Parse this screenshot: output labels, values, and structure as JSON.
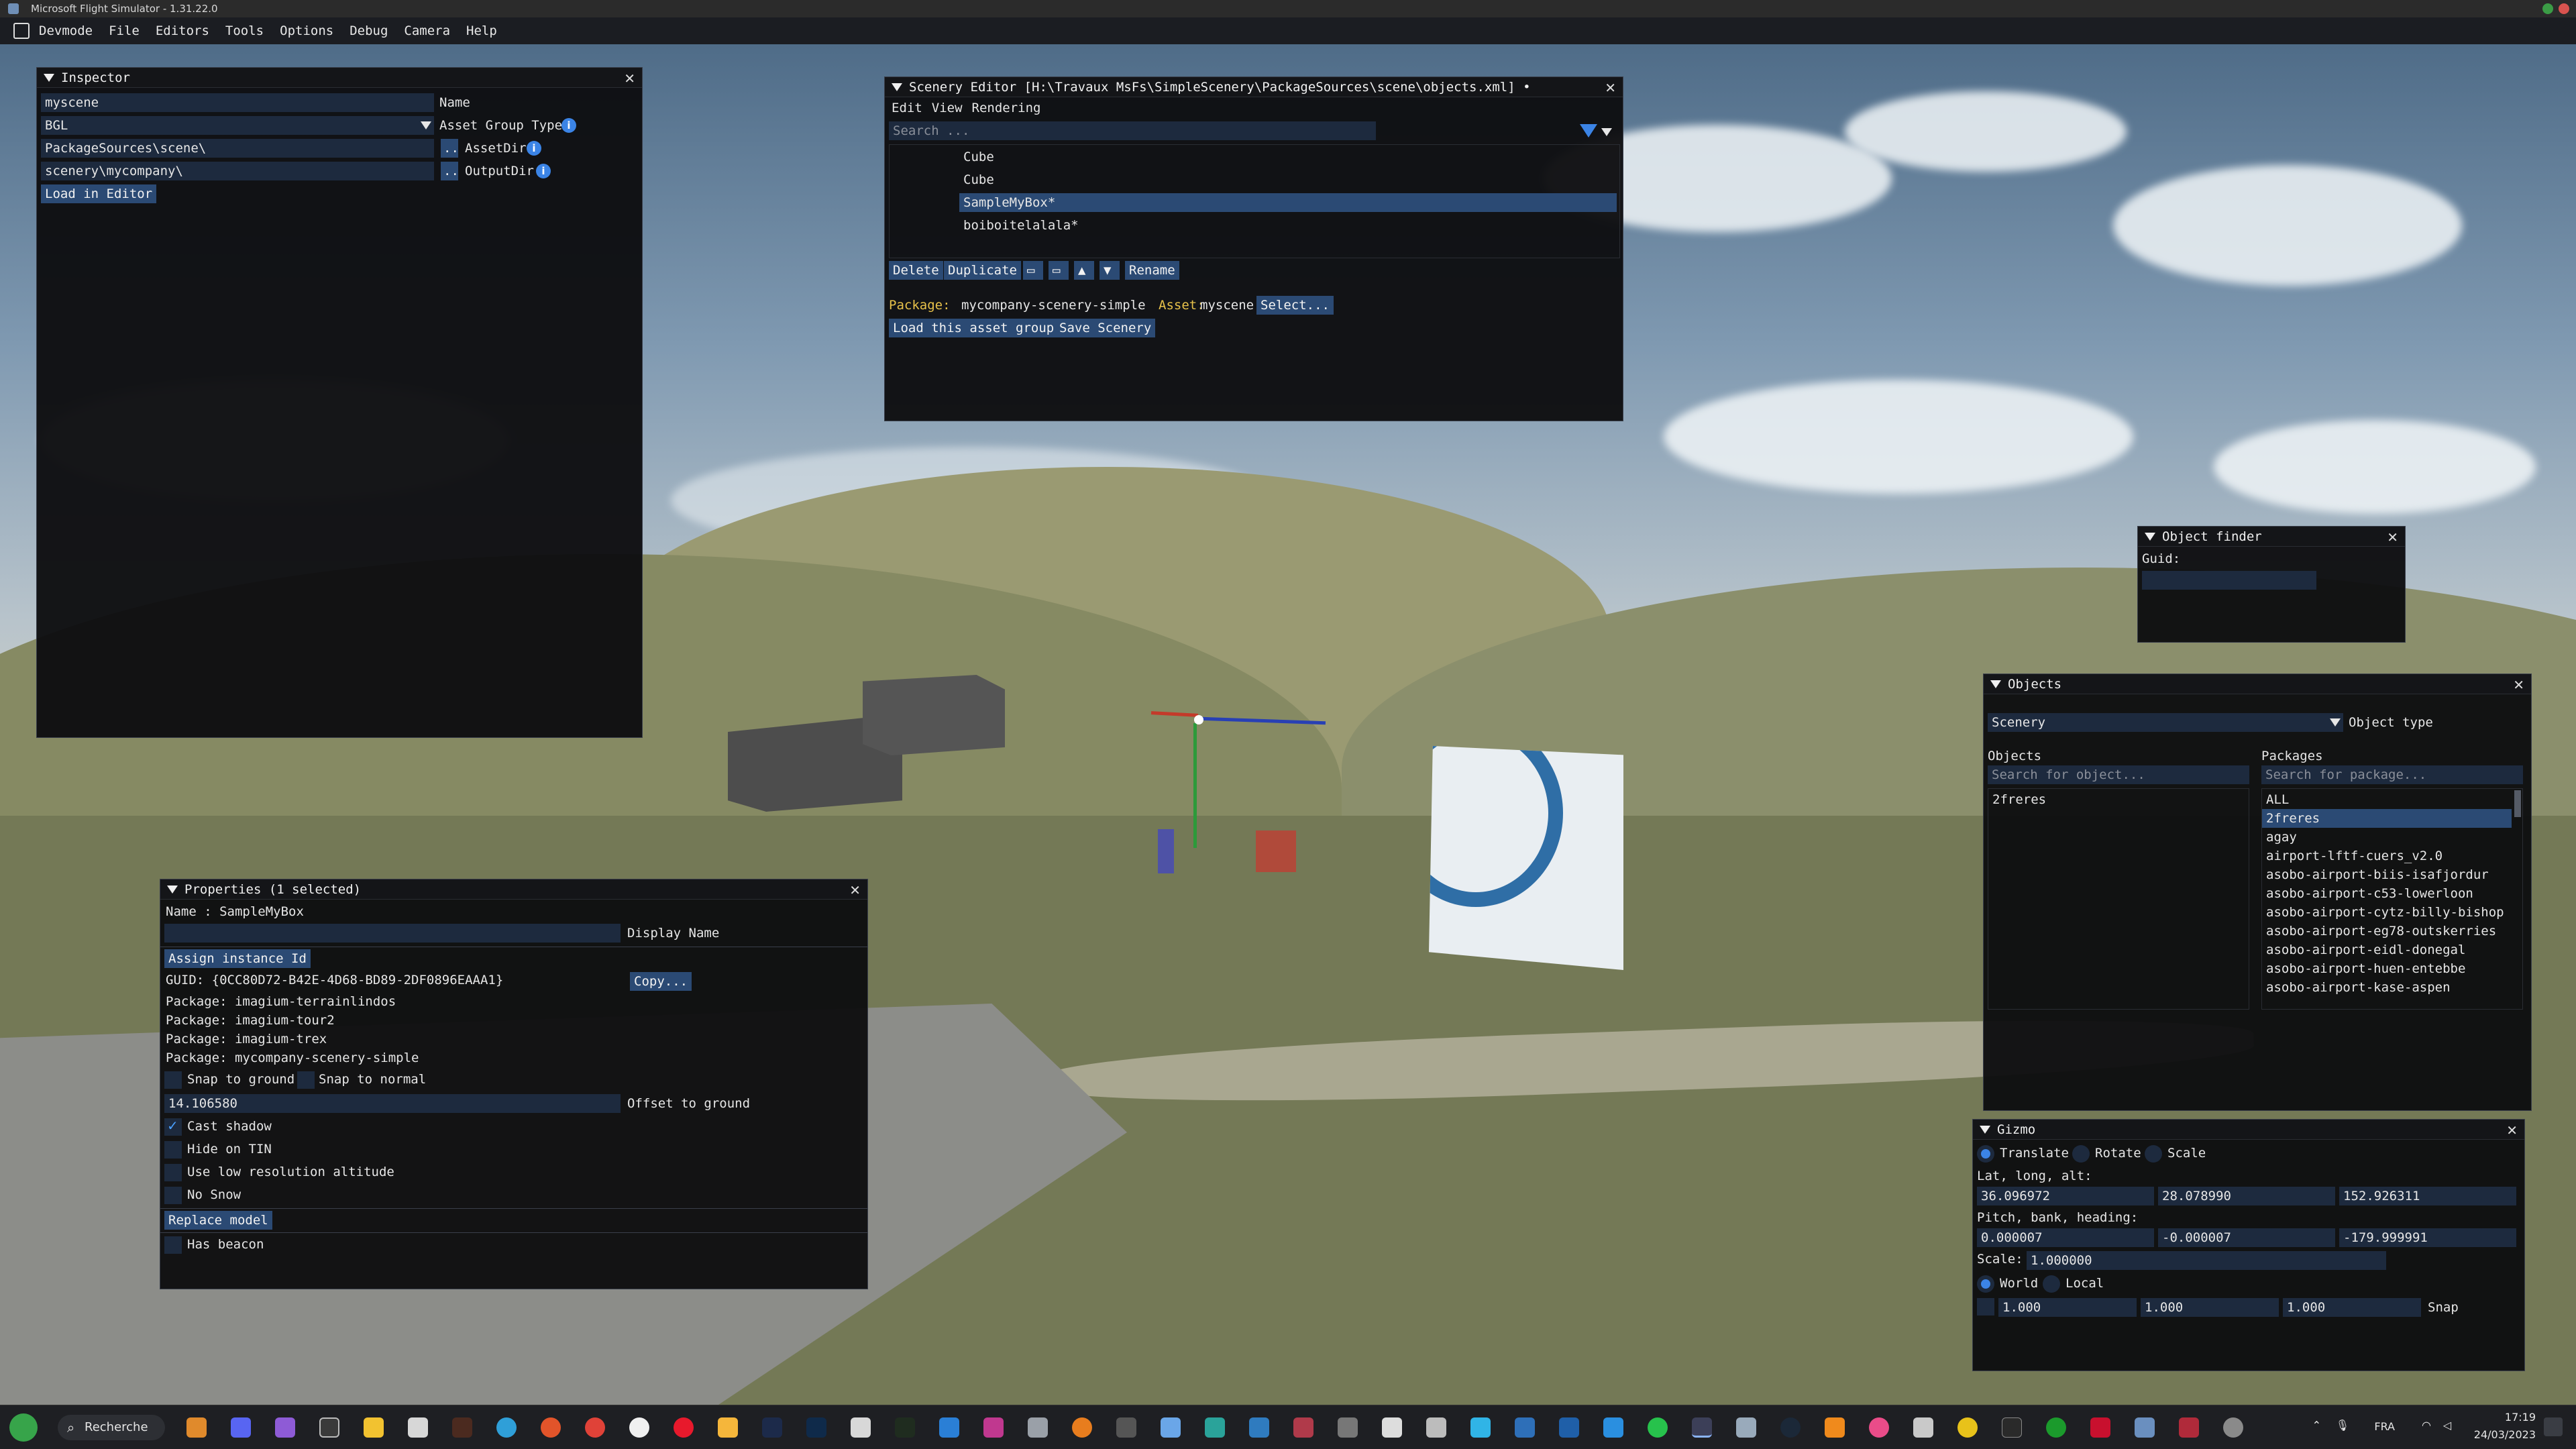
{
  "window": {
    "title": "Microsoft Flight Simulator - 1.31.22.0"
  },
  "menubar": {
    "items": [
      "Devmode",
      "File",
      "Editors",
      "Tools",
      "Options",
      "Debug",
      "Camera",
      "Help"
    ]
  },
  "inspector": {
    "title": "Inspector",
    "name_value": "myscene",
    "name_label": "Name",
    "type_value": "BGL",
    "type_label": "Asset Group Type",
    "assetdir_value": "PackageSources\\scene\\",
    "assetdir_btn": "..",
    "assetdir_label": "AssetDir",
    "outputdir_value": "scenery\\mycompany\\",
    "outputdir_btn": "..",
    "outputdir_label": "OutputDir",
    "load_btn": "Load in Editor",
    "info_glyph": "i"
  },
  "scenery_editor": {
    "title": "Scenery Editor [H:\\Travaux MsFs\\SimpleScenery\\PackageSources\\scene\\objects.xml] •",
    "menu": [
      "Edit",
      "View",
      "Rendering"
    ],
    "search_placeholder": "Search ...",
    "items": [
      "Cube",
      "Cube",
      "SampleMyBox*",
      "boiboitelalala*"
    ],
    "selected_index": 2,
    "buttons": {
      "delete": "Delete",
      "duplicate": "Duplicate",
      "rename": "Rename"
    },
    "package_label": "Package:",
    "package_value": "mycompany-scenery-simple",
    "asset_label": "Asset:",
    "asset_value": "myscene",
    "select_btn": "Select...",
    "load_group_btn": "Load this asset group",
    "save_btn": "Save Scenery"
  },
  "object_finder": {
    "title": "Object finder",
    "guid_label": "Guid:",
    "guid_value": ""
  },
  "objects_window": {
    "title": "Objects",
    "type_value": "Scenery",
    "type_label": "Object type",
    "objects_header": "Objects",
    "packages_header": "Packages",
    "objects_search_placeholder": "Search for object...",
    "packages_search_placeholder": "Search for package...",
    "objects": [
      "2freres"
    ],
    "packages": [
      "ALL",
      "2freres",
      "agay",
      "airport-lftf-cuers_v2.0",
      "asobo-airport-biis-isafjordur",
      "asobo-airport-c53-lowerloon",
      "asobo-airport-cytz-billy-bishop",
      "asobo-airport-eg78-outskerries",
      "asobo-airport-eidl-donegal",
      "asobo-airport-huen-entebbe",
      "asobo-airport-kase-aspen"
    ],
    "selected_package_index": 1
  },
  "properties": {
    "title": "Properties (1 selected)",
    "name_line": "Name : SampleMyBox",
    "display_name_value": "",
    "display_name_label": "Display Name",
    "assign_btn": "Assign instance Id",
    "guid_line": "GUID: {0CC80D72-B42E-4D68-BD89-2DF0896EAAA1}",
    "copy_btn": "Copy...",
    "packages": [
      "Package: imagium-terrainlindos",
      "Package: imagium-tour2",
      "Package: imagium-trex",
      "Package: mycompany-scenery-simple"
    ],
    "snap_ground": "Snap to ground",
    "snap_normal": "Snap to normal",
    "offset_value": "14.106580",
    "offset_label": "Offset to ground",
    "cast_shadow": "Cast shadow",
    "hide_tin": "Hide on TIN",
    "low_res": "Use low resolution altitude",
    "no_snow": "No Snow",
    "replace_btn": "Replace model",
    "has_beacon": "Has beacon",
    "cast_shadow_checked": true
  },
  "gizmo": {
    "title": "Gizmo",
    "modes": [
      "Translate",
      "Rotate",
      "Scale"
    ],
    "active_mode": 0,
    "lla_label": "Lat, long, alt:",
    "lla": [
      "36.096972",
      "28.078990",
      "152.926311"
    ],
    "pbh_label": "Pitch, bank, heading:",
    "pbh": [
      "0.000007",
      "-0.000007",
      "-179.999991"
    ],
    "scale_label": "Scale:",
    "scale_value": "1.000000",
    "space": [
      "World",
      "Local"
    ],
    "active_space": 0,
    "snap_values": [
      "1.000",
      "1.000",
      "1.000"
    ],
    "snap_label": "Snap"
  },
  "taskbar": {
    "search_label": "Recherche",
    "language": "FRA",
    "time": "17:19",
    "date": "24/03/2023"
  },
  "colors": {
    "accent": "#2b4a74",
    "field": "#1d2a3e",
    "window_bg": "#0e0e10",
    "info": "#3b84e6"
  }
}
